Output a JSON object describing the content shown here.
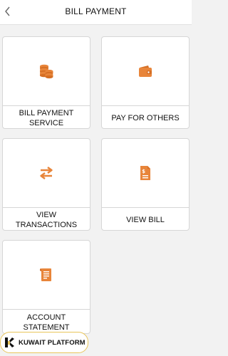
{
  "header": {
    "title": "BILL PAYMENT",
    "back_icon": "chevron-left-icon"
  },
  "tiles": [
    {
      "label": "BILL PAYMENT\nSERVICE",
      "icon": "coins-stack-icon"
    },
    {
      "label": "PAY FOR OTHERS",
      "icon": "wallet-icon"
    },
    {
      "label": "VIEW TRANSACTIONS",
      "icon": "transfer-arrows-icon"
    },
    {
      "label": "VIEW BILL",
      "icon": "bill-document-icon"
    },
    {
      "label": "ACCOUNT\nSTATEMENT",
      "icon": "receipt-icon"
    }
  ],
  "watermark": {
    "text": "KUWAIT PLATFORM"
  },
  "colors": {
    "accent": "#e8853a",
    "background": "#f2f2f2",
    "tile_border": "#d6d6d6",
    "badge_border": "#e9c55a"
  }
}
